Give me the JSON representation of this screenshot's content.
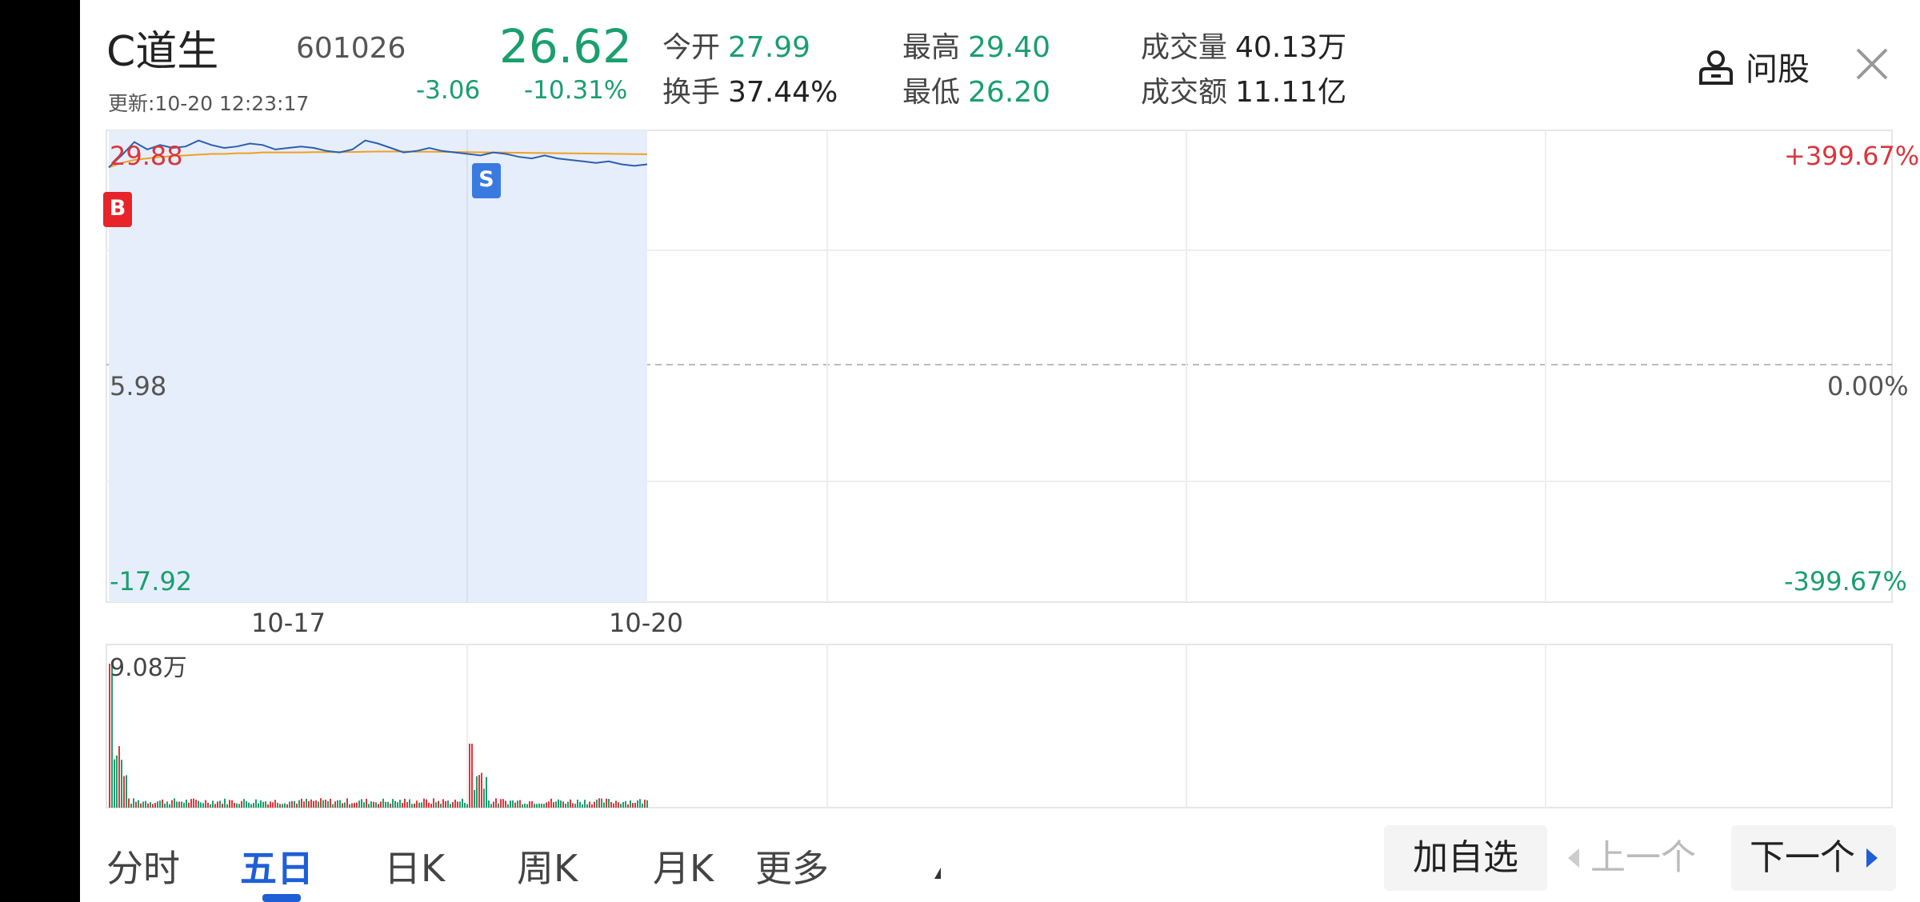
{
  "stock": {
    "name": "C道生",
    "code": "601026",
    "update_time": "更新:10-20 12:23:17",
    "price": "26.62",
    "change": "-3.06",
    "change_pct": "-10.31%"
  },
  "stats": {
    "open_label": "今开",
    "open_value": "27.99",
    "turnover_label": "换手",
    "turnover_value": "37.44%",
    "high_label": "最高",
    "high_value": "29.40",
    "low_label": "最低",
    "low_value": "26.20",
    "volume_label": "成交量",
    "volume_value": "40.13万",
    "amount_label": "成交额",
    "amount_value": "11.11亿"
  },
  "actions": {
    "ask_stock_label": "问股"
  },
  "chart_data": {
    "type": "line",
    "y_left_labels": [
      "29.88",
      "5.98",
      "-17.92"
    ],
    "y_right_labels": [
      "+399.67%",
      "0.00%",
      "-399.67%"
    ],
    "x_labels": [
      "10-17",
      "10-20"
    ],
    "volume_max_label": "9.08万",
    "markers": [
      "B",
      "S"
    ],
    "series": [
      {
        "values": [
          27.6,
          28.4,
          29.3,
          28.8,
          29.1,
          28.9,
          29.0,
          29.4,
          29.1,
          28.9,
          29.0,
          29.2,
          29.1,
          28.8,
          28.9,
          29.0,
          28.9,
          28.7,
          28.6,
          28.8,
          29.4,
          29.2,
          28.9,
          28.6,
          28.7,
          28.9,
          28.7,
          28.6,
          28.5,
          28.4,
          28.6,
          28.5,
          28.3,
          28.2,
          28.4,
          28.2,
          28.1,
          28.0,
          27.9,
          28.0,
          27.8,
          27.7,
          27.8
        ]
      },
      {
        "values": [
          27.6,
          27.9,
          28.1,
          28.2,
          28.3,
          28.35,
          28.4,
          28.45,
          28.5,
          28.5,
          28.55,
          28.55,
          28.6,
          28.6,
          28.6,
          28.6,
          28.62,
          28.62,
          28.63,
          28.63,
          28.65,
          28.66,
          28.66,
          28.66,
          28.65,
          28.65,
          28.64,
          28.63,
          28.62,
          28.61,
          28.6,
          28.59,
          28.58,
          28.57,
          28.56,
          28.55,
          28.54,
          28.53,
          28.52,
          28.51,
          28.5,
          28.49,
          28.48
        ]
      }
    ],
    "colors": {
      "price": "#2b5fb0",
      "avg": "#f0a020",
      "up": "#e0353a",
      "down": "#1a9f6f",
      "fill": "#e6eefb"
    }
  },
  "tabs": [
    "分时",
    "五日",
    "日K",
    "周K",
    "月K",
    "更多"
  ],
  "active_tab": "五日",
  "bottom_buttons": {
    "favorite": "加自选",
    "prev": "上一个",
    "next": "下一个"
  }
}
